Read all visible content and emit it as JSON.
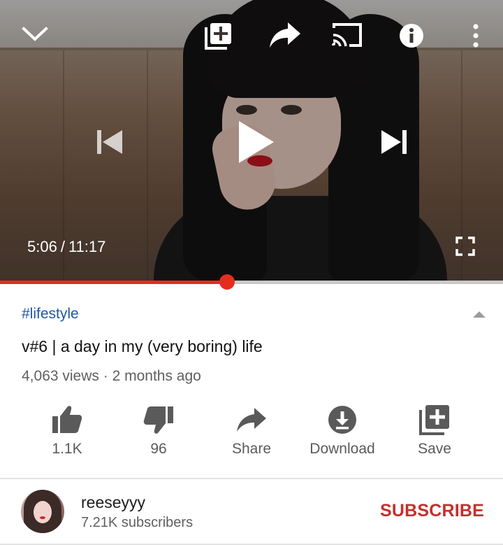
{
  "player": {
    "current_time": "5:06",
    "separator": "/",
    "duration": "11:17",
    "progress_fraction": 0.452,
    "icons": {
      "collapse": "chevron-down-icon",
      "add_to_playlist": "add-to-playlist-icon",
      "share": "share-icon",
      "cast": "cast-icon",
      "info": "info-icon",
      "more": "more-vert-icon",
      "previous": "skip-previous-icon",
      "play": "play-icon",
      "next": "skip-next-icon",
      "fullscreen": "fullscreen-icon"
    },
    "colors": {
      "progress": "#e52d1d"
    }
  },
  "video": {
    "hashtag": "#lifestyle",
    "title": "v#6 | a day in my (very boring) life",
    "views": "4,063 views",
    "meta_separator": "·",
    "age": "2 months ago"
  },
  "actions": [
    {
      "icon": "thumbs-up-icon",
      "label": "1.1K"
    },
    {
      "icon": "thumbs-down-icon",
      "label": "96"
    },
    {
      "icon": "share-icon",
      "label": "Share"
    },
    {
      "icon": "download-icon",
      "label": "Download"
    },
    {
      "icon": "save-icon",
      "label": "Save"
    }
  ],
  "channel": {
    "name": "reeseyyy",
    "subscribers": "7.21K subscribers",
    "subscribe_label": "SUBSCRIBE",
    "subscribe_color": "#c4302b"
  }
}
